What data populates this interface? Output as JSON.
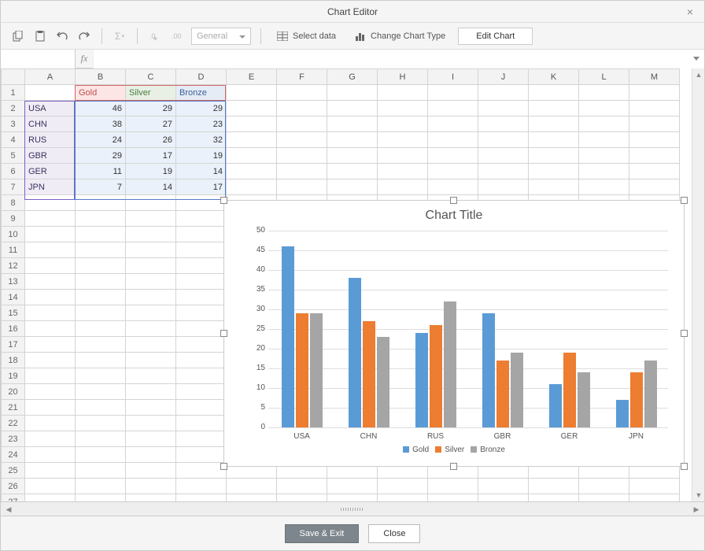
{
  "dialog": {
    "title": "Chart Editor"
  },
  "toolbar": {
    "format_label": "General",
    "select_data": "Select data",
    "change_type": "Change Chart Type",
    "edit_chart": "Edit Chart"
  },
  "namebox": {
    "value": ""
  },
  "columns": [
    "A",
    "B",
    "C",
    "D",
    "E",
    "F",
    "G",
    "H",
    "I",
    "J",
    "K",
    "L",
    "M"
  ],
  "row_count": 28,
  "cells": {
    "B1": "Gold",
    "C1": "Silver",
    "D1": "Bronze",
    "A2": "USA",
    "B2": "46",
    "C2": "29",
    "D2": "29",
    "A3": "CHN",
    "B3": "38",
    "C3": "27",
    "D3": "23",
    "A4": "RUS",
    "B4": "24",
    "C4": "26",
    "D4": "32",
    "A5": "GBR",
    "B5": "29",
    "C5": "17",
    "D5": "19",
    "A6": "GER",
    "B6": "11",
    "C6": "19",
    "D6": "14",
    "A7": "JPN",
    "B7": "7",
    "C7": "14",
    "D7": "17"
  },
  "chart_data": {
    "type": "bar",
    "title": "Chart Title",
    "categories": [
      "USA",
      "CHN",
      "RUS",
      "GBR",
      "GER",
      "JPN"
    ],
    "series": [
      {
        "name": "Gold",
        "values": [
          46,
          38,
          24,
          29,
          11,
          7
        ],
        "color": "#5b9bd5"
      },
      {
        "name": "Silver",
        "values": [
          29,
          27,
          26,
          17,
          19,
          14
        ],
        "color": "#ed7d31"
      },
      {
        "name": "Bronze",
        "values": [
          29,
          23,
          32,
          19,
          14,
          17
        ],
        "color": "#a5a5a5"
      }
    ],
    "ylim": [
      0,
      50
    ],
    "ytick": 5,
    "xlabel": "",
    "ylabel": ""
  },
  "footer": {
    "save": "Save & Exit",
    "close": "Close"
  }
}
